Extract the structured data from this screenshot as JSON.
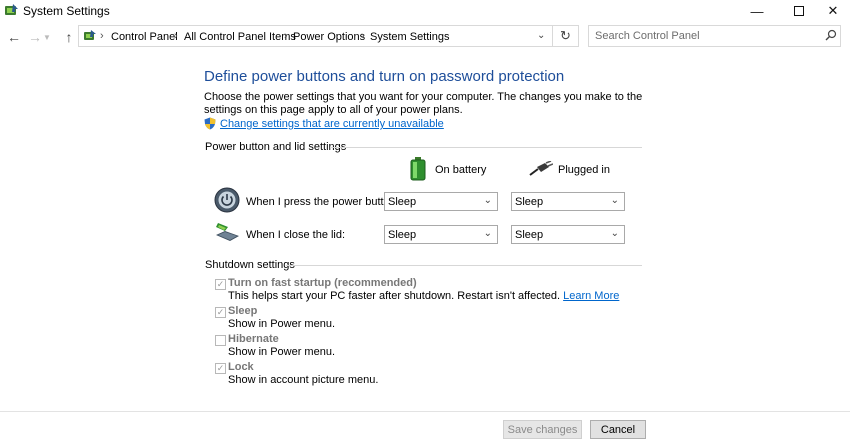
{
  "window": {
    "title": "System Settings",
    "icons": {
      "app": "power-options-icon",
      "minimize": "minimize-icon",
      "maximize": "maximize-icon",
      "close": "close-icon"
    }
  },
  "nav": {
    "back": "back-arrow-icon",
    "forward": "forward-arrow-icon",
    "up": "up-arrow-icon",
    "breadcrumbs": [
      "Control Panel",
      "All Control Panel Items",
      "Power Options",
      "System Settings"
    ],
    "search_placeholder": "Search Control Panel"
  },
  "main": {
    "heading": "Define power buttons and turn on password protection",
    "description": "Choose the power settings that you want for your computer. The changes you make to the settings on this page apply to all of your power plans.",
    "change_link": "Change settings that are currently unavailable",
    "power_section": {
      "title": "Power button and lid settings",
      "col_battery": "On battery",
      "col_plugged": "Plugged in",
      "rows": [
        {
          "label": "When I press the power button:",
          "battery": "Sleep",
          "plugged": "Sleep"
        },
        {
          "label": "When I close the lid:",
          "battery": "Sleep",
          "plugged": "Sleep"
        }
      ]
    },
    "shutdown_section": {
      "title": "Shutdown settings",
      "options": [
        {
          "title": "Turn on fast startup (recommended)",
          "desc": "This helps start your PC faster after shutdown. Restart isn't affected.",
          "link": "Learn More",
          "checked": true
        },
        {
          "title": "Sleep",
          "desc": "Show in Power menu.",
          "checked": true
        },
        {
          "title": "Hibernate",
          "desc": "Show in Power menu.",
          "checked": false
        },
        {
          "title": "Lock",
          "desc": "Show in account picture menu.",
          "checked": true
        }
      ]
    }
  },
  "footer": {
    "save": "Save changes",
    "cancel": "Cancel"
  },
  "colors": {
    "heading": "#1e4e9a",
    "link": "#0066cc",
    "disabled_text": "#777777"
  }
}
